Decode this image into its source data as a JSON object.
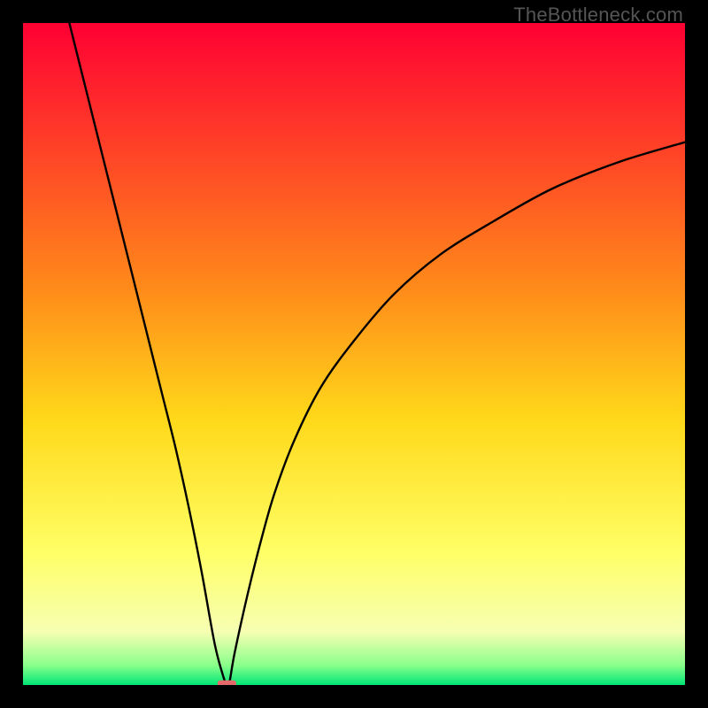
{
  "watermark": "TheBottleneck.com",
  "chart_data": {
    "type": "line",
    "title": "",
    "xlabel": "",
    "ylabel": "",
    "xlim": [
      0,
      100
    ],
    "ylim": [
      0,
      100
    ],
    "grid": false,
    "legend": false,
    "gradient_stops": [
      {
        "offset": 0,
        "color": "#ff0033"
      },
      {
        "offset": 40,
        "color": "#ff8a1a"
      },
      {
        "offset": 60,
        "color": "#ffd91a"
      },
      {
        "offset": 80,
        "color": "#ffff66"
      },
      {
        "offset": 92,
        "color": "#f6ffb3"
      },
      {
        "offset": 97,
        "color": "#8aff8a"
      },
      {
        "offset": 100,
        "color": "#00e676"
      }
    ],
    "series": [
      {
        "name": "bottleneck-curve",
        "x": [
          7,
          9,
          11,
          13,
          15,
          17,
          19,
          21,
          23,
          25,
          27,
          29,
          30.5,
          30.8,
          31.2,
          32,
          34,
          36,
          38,
          41,
          45,
          50,
          56,
          63,
          71,
          80,
          90,
          100
        ],
        "y": [
          100,
          92,
          84,
          76,
          68,
          60,
          52,
          44,
          36,
          27,
          17,
          6,
          0.5,
          0,
          0.5,
          5,
          14,
          22,
          29,
          37,
          45,
          52,
          59,
          65,
          70,
          75,
          79,
          82
        ]
      }
    ],
    "annotations": [
      {
        "name": "min-marker",
        "x": 30.8,
        "y": 0.2,
        "color": "#e46a6a",
        "width": 2.8,
        "height": 1.0
      }
    ]
  }
}
